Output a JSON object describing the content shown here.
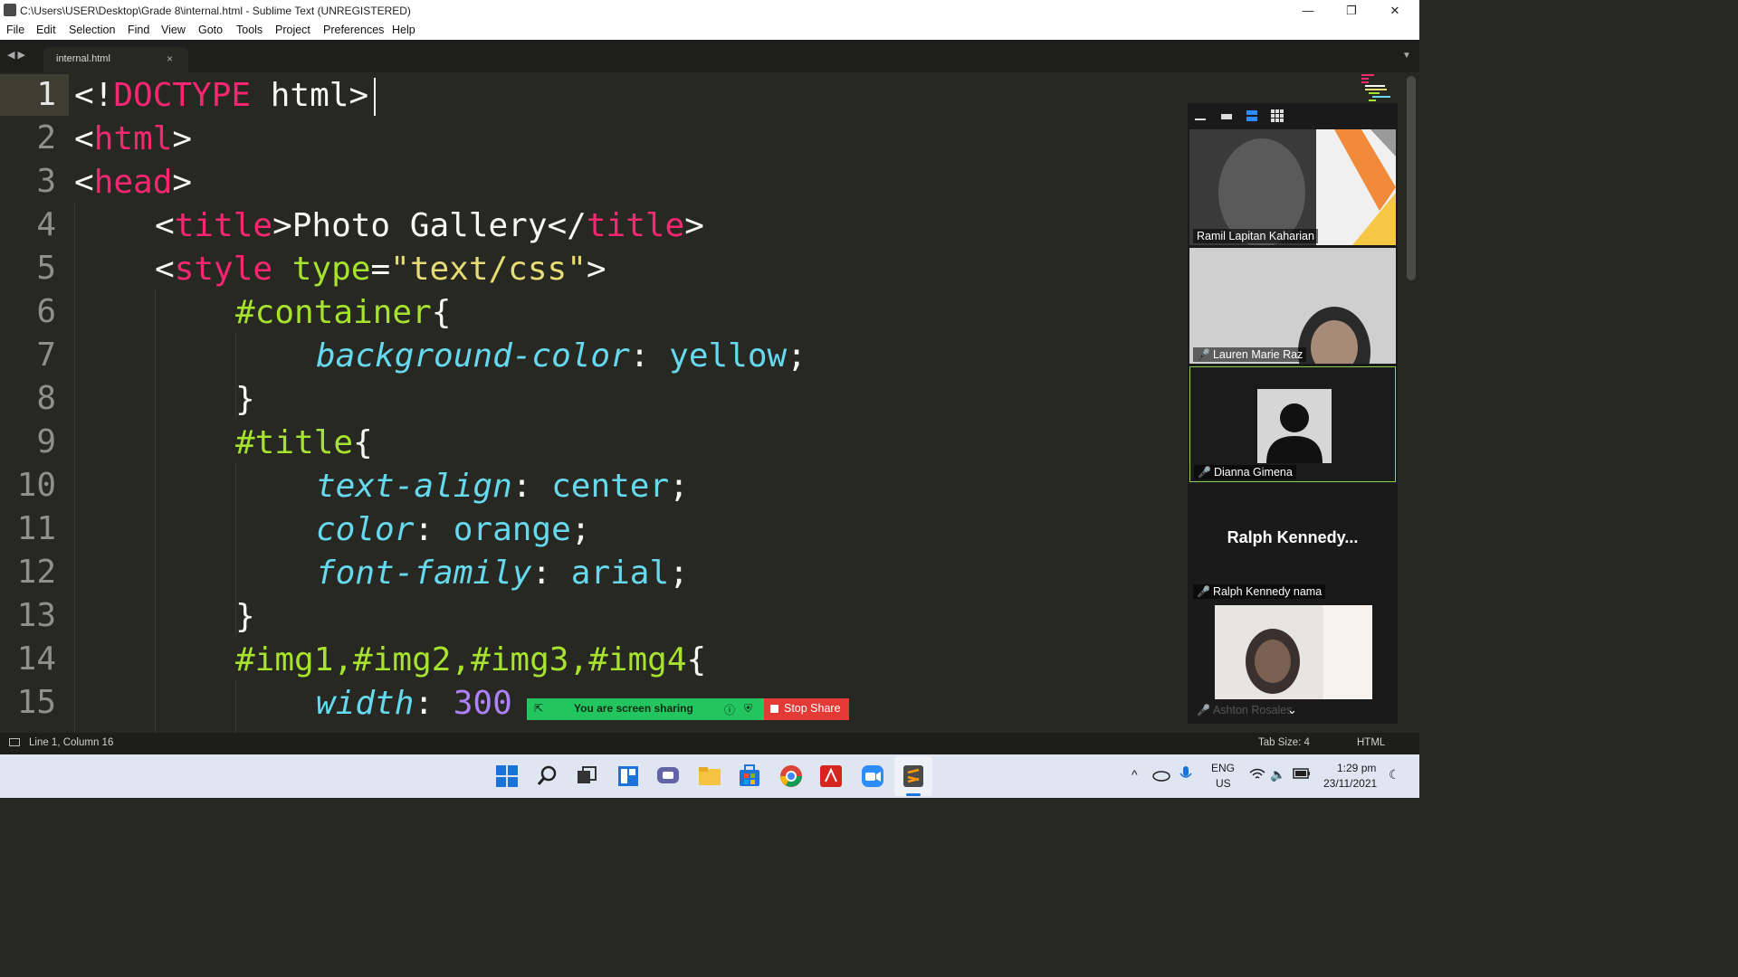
{
  "window": {
    "title": "C:\\Users\\USER\\Desktop\\Grade 8\\internal.html - Sublime Text (UNREGISTERED)",
    "minimize": "—",
    "restore": "❐",
    "close": "✕"
  },
  "menu": [
    "File",
    "Edit",
    "Selection",
    "Find",
    "View",
    "Goto",
    "Tools",
    "Project",
    "Preferences",
    "Help"
  ],
  "tab": {
    "name": "internal.html",
    "close": "×",
    "nav": "◀ ▶",
    "dropdown": "▼"
  },
  "lines": [
    "1",
    "2",
    "3",
    "4",
    "5",
    "6",
    "7",
    "8",
    "9",
    "10",
    "11",
    "12",
    "13",
    "14",
    "15"
  ],
  "code": {
    "l1": {
      "a": "<!",
      "b": "DOCTYPE",
      "c": " html>"
    },
    "l2": {
      "a": "<",
      "b": "html",
      "c": ">"
    },
    "l3": {
      "a": "<",
      "b": "head",
      "c": ">"
    },
    "l4": {
      "a": "<",
      "b": "title",
      "c": ">Photo Gallery</",
      "d": "title",
      "e": ">"
    },
    "l5": {
      "a": "<",
      "b": "style",
      "c": " ",
      "d": "type",
      "e": "=",
      "f": "\"text/css\"",
      "g": ">"
    },
    "l6": {
      "a": "#container",
      "b": "{"
    },
    "l7": {
      "a": "background-color",
      "b": ": ",
      "c": "yellow",
      "d": ";"
    },
    "l8": {
      "a": "}"
    },
    "l9": {
      "a": "#title",
      "b": "{"
    },
    "l10": {
      "a": "text-align",
      "b": ": ",
      "c": "center",
      "d": ";"
    },
    "l11": {
      "a": "color",
      "b": ": ",
      "c": "orange",
      "d": ";"
    },
    "l12": {
      "a": "font-family",
      "b": ": ",
      "c": "arial",
      "d": ";"
    },
    "l13": {
      "a": "}"
    },
    "l14": {
      "a": "#img1,#img2,#img3,#img4",
      "b": "{"
    },
    "l15": {
      "a": "width",
      "b": ": ",
      "c": "300"
    }
  },
  "zoom": {
    "participants": [
      {
        "name": "Ramil Lapitan Kaharian",
        "muted": false
      },
      {
        "name": "Lauren Marie Raz",
        "muted": true
      },
      {
        "name": "Dianna Gimena",
        "muted": true
      },
      {
        "name": "Ralph Kennedy nama",
        "muted": true,
        "display": "Ralph  Kennedy..."
      },
      {
        "name": "Ashton Rosales",
        "muted": true
      }
    ],
    "share_text": "You are screen sharing",
    "stop_share": "Stop Share"
  },
  "status": {
    "position": "Line 1, Column 16",
    "tab_size": "Tab Size: 4",
    "syntax": "HTML"
  },
  "taskbar": {
    "lang": "ENG",
    "region": "US",
    "time": "1:29 pm",
    "date": "23/11/2021"
  },
  "colors": {
    "editor_bg": "#272822",
    "keyword": "#f92672",
    "selector": "#a6e22e",
    "property": "#66d9ef",
    "number": "#ae81ff",
    "string": "#e6db74",
    "share_green": "#22c55e",
    "stop_red": "#e53935"
  }
}
